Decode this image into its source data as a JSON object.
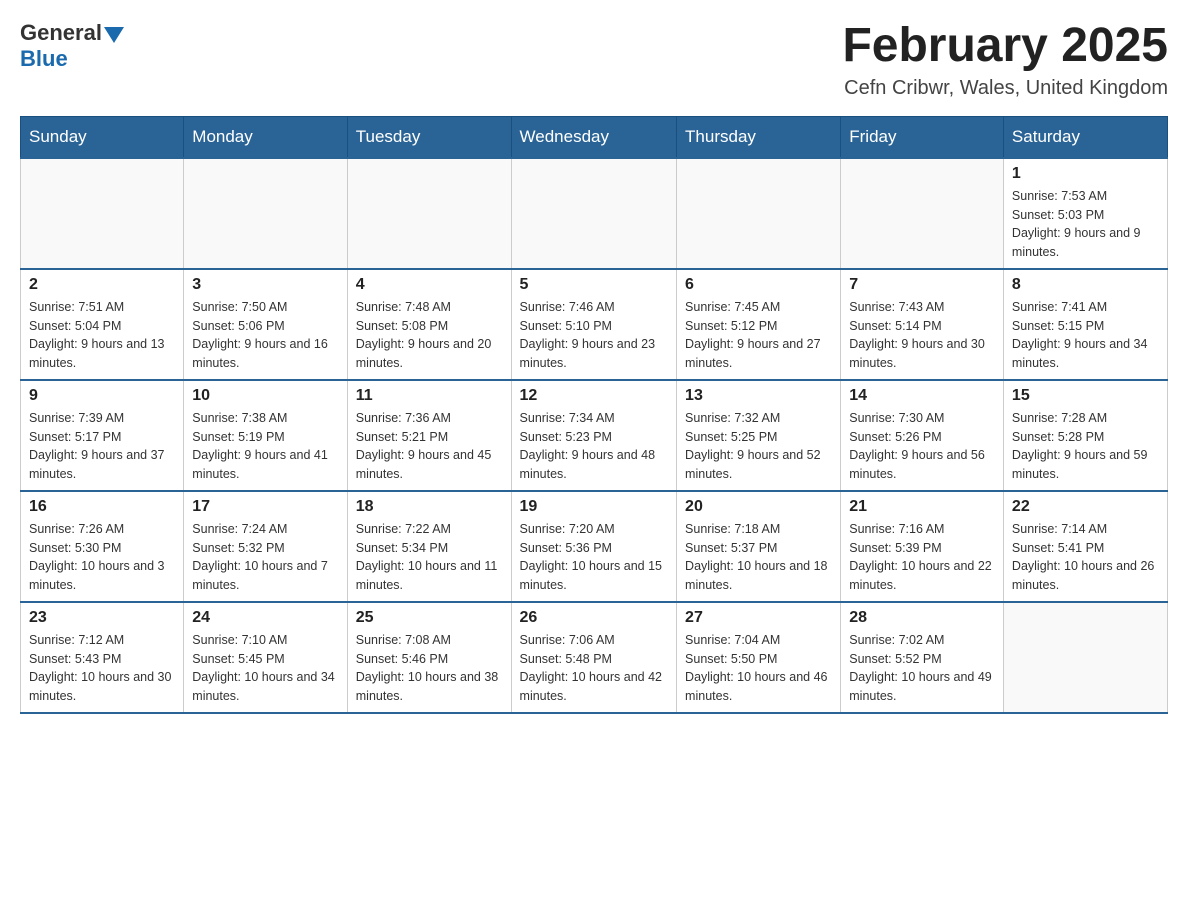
{
  "header": {
    "logo_general": "General",
    "logo_blue": "Blue",
    "title": "February 2025",
    "location": "Cefn Cribwr, Wales, United Kingdom"
  },
  "days_of_week": [
    "Sunday",
    "Monday",
    "Tuesday",
    "Wednesday",
    "Thursday",
    "Friday",
    "Saturday"
  ],
  "weeks": [
    {
      "cells": [
        {
          "day": "",
          "sunrise": "",
          "sunset": "",
          "daylight": ""
        },
        {
          "day": "",
          "sunrise": "",
          "sunset": "",
          "daylight": ""
        },
        {
          "day": "",
          "sunrise": "",
          "sunset": "",
          "daylight": ""
        },
        {
          "day": "",
          "sunrise": "",
          "sunset": "",
          "daylight": ""
        },
        {
          "day": "",
          "sunrise": "",
          "sunset": "",
          "daylight": ""
        },
        {
          "day": "",
          "sunrise": "",
          "sunset": "",
          "daylight": ""
        },
        {
          "day": "1",
          "sunrise": "Sunrise: 7:53 AM",
          "sunset": "Sunset: 5:03 PM",
          "daylight": "Daylight: 9 hours and 9 minutes."
        }
      ]
    },
    {
      "cells": [
        {
          "day": "2",
          "sunrise": "Sunrise: 7:51 AM",
          "sunset": "Sunset: 5:04 PM",
          "daylight": "Daylight: 9 hours and 13 minutes."
        },
        {
          "day": "3",
          "sunrise": "Sunrise: 7:50 AM",
          "sunset": "Sunset: 5:06 PM",
          "daylight": "Daylight: 9 hours and 16 minutes."
        },
        {
          "day": "4",
          "sunrise": "Sunrise: 7:48 AM",
          "sunset": "Sunset: 5:08 PM",
          "daylight": "Daylight: 9 hours and 20 minutes."
        },
        {
          "day": "5",
          "sunrise": "Sunrise: 7:46 AM",
          "sunset": "Sunset: 5:10 PM",
          "daylight": "Daylight: 9 hours and 23 minutes."
        },
        {
          "day": "6",
          "sunrise": "Sunrise: 7:45 AM",
          "sunset": "Sunset: 5:12 PM",
          "daylight": "Daylight: 9 hours and 27 minutes."
        },
        {
          "day": "7",
          "sunrise": "Sunrise: 7:43 AM",
          "sunset": "Sunset: 5:14 PM",
          "daylight": "Daylight: 9 hours and 30 minutes."
        },
        {
          "day": "8",
          "sunrise": "Sunrise: 7:41 AM",
          "sunset": "Sunset: 5:15 PM",
          "daylight": "Daylight: 9 hours and 34 minutes."
        }
      ]
    },
    {
      "cells": [
        {
          "day": "9",
          "sunrise": "Sunrise: 7:39 AM",
          "sunset": "Sunset: 5:17 PM",
          "daylight": "Daylight: 9 hours and 37 minutes."
        },
        {
          "day": "10",
          "sunrise": "Sunrise: 7:38 AM",
          "sunset": "Sunset: 5:19 PM",
          "daylight": "Daylight: 9 hours and 41 minutes."
        },
        {
          "day": "11",
          "sunrise": "Sunrise: 7:36 AM",
          "sunset": "Sunset: 5:21 PM",
          "daylight": "Daylight: 9 hours and 45 minutes."
        },
        {
          "day": "12",
          "sunrise": "Sunrise: 7:34 AM",
          "sunset": "Sunset: 5:23 PM",
          "daylight": "Daylight: 9 hours and 48 minutes."
        },
        {
          "day": "13",
          "sunrise": "Sunrise: 7:32 AM",
          "sunset": "Sunset: 5:25 PM",
          "daylight": "Daylight: 9 hours and 52 minutes."
        },
        {
          "day": "14",
          "sunrise": "Sunrise: 7:30 AM",
          "sunset": "Sunset: 5:26 PM",
          "daylight": "Daylight: 9 hours and 56 minutes."
        },
        {
          "day": "15",
          "sunrise": "Sunrise: 7:28 AM",
          "sunset": "Sunset: 5:28 PM",
          "daylight": "Daylight: 9 hours and 59 minutes."
        }
      ]
    },
    {
      "cells": [
        {
          "day": "16",
          "sunrise": "Sunrise: 7:26 AM",
          "sunset": "Sunset: 5:30 PM",
          "daylight": "Daylight: 10 hours and 3 minutes."
        },
        {
          "day": "17",
          "sunrise": "Sunrise: 7:24 AM",
          "sunset": "Sunset: 5:32 PM",
          "daylight": "Daylight: 10 hours and 7 minutes."
        },
        {
          "day": "18",
          "sunrise": "Sunrise: 7:22 AM",
          "sunset": "Sunset: 5:34 PM",
          "daylight": "Daylight: 10 hours and 11 minutes."
        },
        {
          "day": "19",
          "sunrise": "Sunrise: 7:20 AM",
          "sunset": "Sunset: 5:36 PM",
          "daylight": "Daylight: 10 hours and 15 minutes."
        },
        {
          "day": "20",
          "sunrise": "Sunrise: 7:18 AM",
          "sunset": "Sunset: 5:37 PM",
          "daylight": "Daylight: 10 hours and 18 minutes."
        },
        {
          "day": "21",
          "sunrise": "Sunrise: 7:16 AM",
          "sunset": "Sunset: 5:39 PM",
          "daylight": "Daylight: 10 hours and 22 minutes."
        },
        {
          "day": "22",
          "sunrise": "Sunrise: 7:14 AM",
          "sunset": "Sunset: 5:41 PM",
          "daylight": "Daylight: 10 hours and 26 minutes."
        }
      ]
    },
    {
      "cells": [
        {
          "day": "23",
          "sunrise": "Sunrise: 7:12 AM",
          "sunset": "Sunset: 5:43 PM",
          "daylight": "Daylight: 10 hours and 30 minutes."
        },
        {
          "day": "24",
          "sunrise": "Sunrise: 7:10 AM",
          "sunset": "Sunset: 5:45 PM",
          "daylight": "Daylight: 10 hours and 34 minutes."
        },
        {
          "day": "25",
          "sunrise": "Sunrise: 7:08 AM",
          "sunset": "Sunset: 5:46 PM",
          "daylight": "Daylight: 10 hours and 38 minutes."
        },
        {
          "day": "26",
          "sunrise": "Sunrise: 7:06 AM",
          "sunset": "Sunset: 5:48 PM",
          "daylight": "Daylight: 10 hours and 42 minutes."
        },
        {
          "day": "27",
          "sunrise": "Sunrise: 7:04 AM",
          "sunset": "Sunset: 5:50 PM",
          "daylight": "Daylight: 10 hours and 46 minutes."
        },
        {
          "day": "28",
          "sunrise": "Sunrise: 7:02 AM",
          "sunset": "Sunset: 5:52 PM",
          "daylight": "Daylight: 10 hours and 49 minutes."
        },
        {
          "day": "",
          "sunrise": "",
          "sunset": "",
          "daylight": ""
        }
      ]
    }
  ]
}
